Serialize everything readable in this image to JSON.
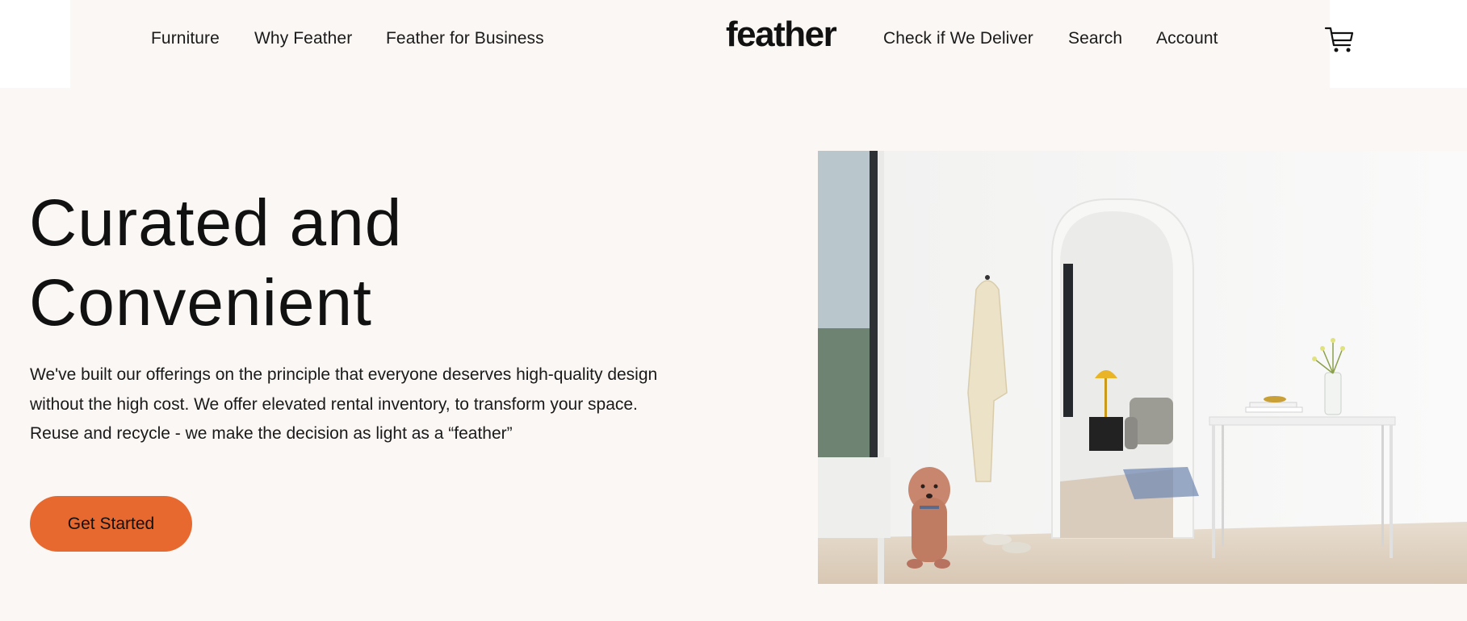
{
  "nav": {
    "left_links": [
      "Furniture",
      "Why Feather",
      "Feather for Business"
    ],
    "logo": "feather",
    "right_links": [
      "Check if We Deliver",
      "Search",
      "Account"
    ],
    "cart_icon": "cart-icon"
  },
  "hero": {
    "headline_line1": "Curated and",
    "headline_line2": "Convenient",
    "description_line1": "We've built our offerings on the principle that everyone deserves high-quality design",
    "description_line2": "without the high cost. We offer elevated rental inventory, to transform your space.",
    "description_line3": "Reuse and recycle - we make the decision as light as a “feather”",
    "cta_label": "Get Started",
    "image_alt": "Bright white room with arched doorway, coat on hook, yellow lamp, console table and a dog"
  },
  "colors": {
    "background": "#faf7f4",
    "accent": "#e8692f",
    "text": "#111111"
  }
}
